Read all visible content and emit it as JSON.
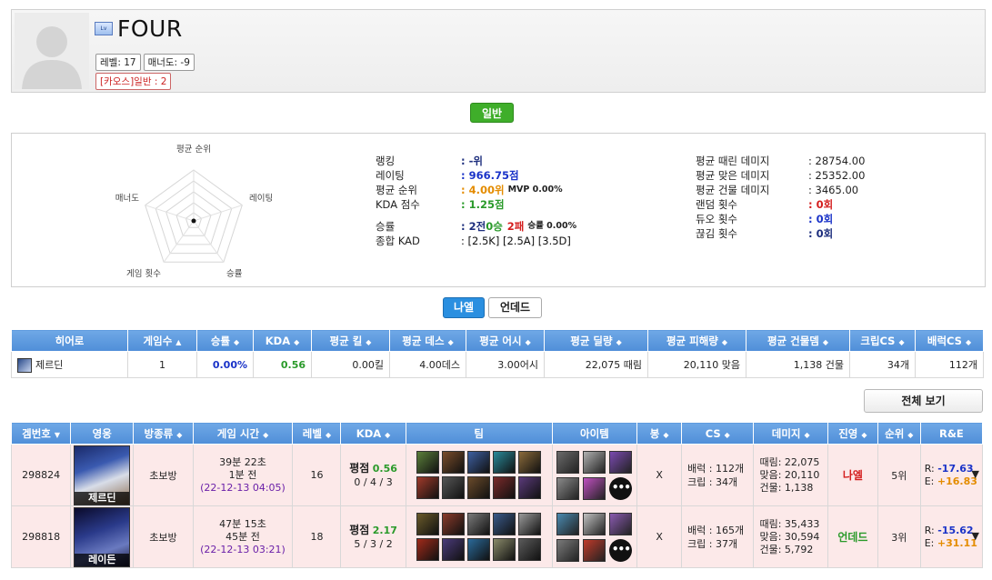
{
  "profile": {
    "name": "FOUR",
    "level_chip": "레벨: 17",
    "manner_chip": "매너도: -9",
    "chaos_chip": "[카오스]일반 : 2"
  },
  "mode_button": "일반",
  "radar": {
    "labels": [
      "평균 순위",
      "레이팅",
      "승률",
      "게임 횟수",
      "매너도"
    ]
  },
  "stats_left": [
    {
      "k": "랭킹",
      "v": ": -위"
    },
    {
      "k": "레이팅",
      "v": ": 966.75점"
    },
    {
      "k": "평균 순위",
      "v": ": 4.00위",
      "extra": "MVP 0.00%"
    },
    {
      "k": "KDA 점수",
      "v": ": 1.25점"
    },
    {
      "k": "승률",
      "v_prefix": ": 2전 ",
      "v_win": "0승",
      "v_loss": "2패",
      "extra": "승률 0.00%"
    },
    {
      "k": "종합 KAD",
      "v": ": [2.5K] [2.5A] [3.5D]"
    }
  ],
  "stats_right": [
    {
      "k": "평균 때린 데미지",
      "v": ": 28754.00"
    },
    {
      "k": "평균 맞은 데미지",
      "v": ": 25352.00"
    },
    {
      "k": "평균 건물 데미지",
      "v": ": 3465.00"
    },
    {
      "k": "랜덤 횟수",
      "v": ": 0회"
    },
    {
      "k": "듀오 횟수",
      "v": ": 0회"
    },
    {
      "k": "끊김 횟수",
      "v": ": 0회"
    }
  ],
  "faction_tabs": [
    "나엘",
    "언데드"
  ],
  "hero_table": {
    "headers": [
      "히어로",
      "게임수",
      "승률",
      "KDA",
      "평균 킬",
      "평균 데스",
      "평균 어시",
      "평균 딜량",
      "평균 피해량",
      "평균 건물뎀",
      "크립CS",
      "배럭CS"
    ],
    "row": {
      "hero": "제르딘",
      "games": "1",
      "winrate": "0.00%",
      "kda": "0.56",
      "avg_kill": "0.00킬",
      "avg_death": "4.00데스",
      "avg_assist": "3.00어시",
      "avg_deal": "22,075 때림",
      "avg_taken": "20,110 맞음",
      "avg_building": "1,138 건물",
      "creep_cs": "34개",
      "barrack_cs": "112개"
    }
  },
  "view_all": "전체 보기",
  "games_table": {
    "headers": [
      "겜번호",
      "영웅",
      "방종류",
      "게임 시간",
      "레벨",
      "KDA",
      "팀",
      "아이템",
      "봉",
      "CS",
      "데미지",
      "진영",
      "순위",
      "R&E"
    ],
    "rows": [
      {
        "id": "298824",
        "hero": "제르딘",
        "room": "초보방",
        "duration": "39분 22초",
        "ago": "1분 전",
        "date": "(22-12-13 04:05)",
        "level": "16",
        "kda_label": "평점",
        "kda_value": "0.56",
        "kda_detail": "0 / 4 / 3",
        "bong": "X",
        "cs_barrack": "배럭 : 112개",
        "cs_creep": "크립 : 34개",
        "dmg_deal": "때림: 22,075",
        "dmg_taken": "맞음: 20,110",
        "dmg_building": "건물: 1,138",
        "faction": "나엘",
        "rank": "5위",
        "r_label": "R:",
        "r_value": "-17.63",
        "e_label": "E:",
        "e_value": "+16.83",
        "team_icons": [
          "#5b7f3a",
          "#7a4c2a",
          "#3d5fa0",
          "#2a8a9a",
          "#8a6a3a",
          "#a03a2a",
          "#555555",
          "#6a4a2a",
          "#7a2a2a",
          "#5a3a7a"
        ],
        "item_icons": [
          "#6a6a6a",
          "#b0b0b0",
          "#7a4ab0",
          "#8a8a8a",
          "#c050c0"
        ]
      },
      {
        "id": "298818",
        "hero": "레이든",
        "room": "초보방",
        "duration": "47분 15초",
        "ago": "45분 전",
        "date": "(22-12-13 03:21)",
        "level": "18",
        "kda_label": "평점",
        "kda_value": "2.17",
        "kda_detail": "5 / 3 / 2",
        "bong": "X",
        "cs_barrack": "배럭 : 165개",
        "cs_creep": "크립 : 37개",
        "dmg_deal": "때림: 35,433",
        "dmg_taken": "맞음: 30,594",
        "dmg_building": "건물: 5,792",
        "faction": "언데드",
        "rank": "3위",
        "r_label": "R:",
        "r_value": "-15.62",
        "e_label": "E:",
        "e_value": "+31.11",
        "team_icons": [
          "#6a5a2a",
          "#8a3a2a",
          "#7a7a7a",
          "#3a5a8a",
          "#9a9a9a",
          "#a02a1a",
          "#4a3a7a",
          "#2a6a9a",
          "#8a8a6a",
          "#5a5a5a"
        ],
        "item_icons": [
          "#4a8ab0",
          "#c0c0c0",
          "#8a5ab0",
          "#7a7a7a",
          "#c03a2a"
        ]
      }
    ]
  },
  "colors": {
    "header_blue": "#4f8ed8",
    "win_green": "#3fae2a",
    "row_pink": "#fce9e9",
    "ne_red": "#d41e1e",
    "ud_green": "#2a9a2a"
  }
}
